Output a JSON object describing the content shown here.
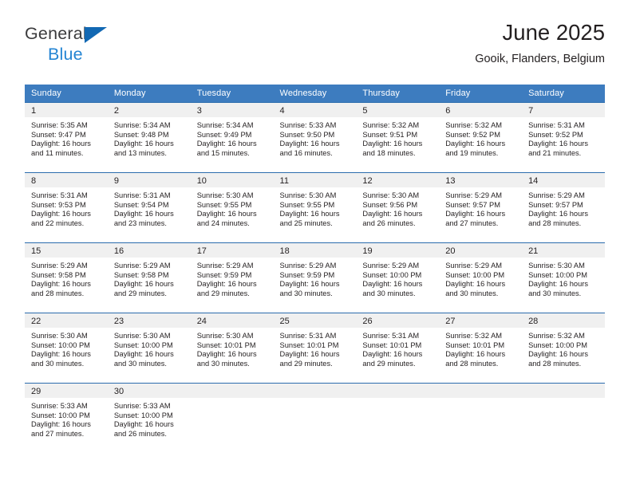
{
  "brand": {
    "name_part1": "General",
    "name_part2": "Blue",
    "triangle_color": "#1268b3",
    "text_color_1": "#3b3b3d",
    "text_color_2": "#2585d3"
  },
  "header": {
    "title": "June 2025",
    "subtitle": "Gooik, Flanders, Belgium"
  },
  "theme": {
    "header_bg": "#3d7cbf",
    "row_divider": "#2b6cad",
    "daynum_bg": "#f0f0f0",
    "text": "#231f20"
  },
  "weekday_headers": [
    "Sunday",
    "Monday",
    "Tuesday",
    "Wednesday",
    "Thursday",
    "Friday",
    "Saturday"
  ],
  "weeks": [
    {
      "days": [
        {
          "num": "1",
          "sunrise": "Sunrise: 5:35 AM",
          "sunset": "Sunset: 9:47 PM",
          "daylight1": "Daylight: 16 hours",
          "daylight2": "and 11 minutes."
        },
        {
          "num": "2",
          "sunrise": "Sunrise: 5:34 AM",
          "sunset": "Sunset: 9:48 PM",
          "daylight1": "Daylight: 16 hours",
          "daylight2": "and 13 minutes."
        },
        {
          "num": "3",
          "sunrise": "Sunrise: 5:34 AM",
          "sunset": "Sunset: 9:49 PM",
          "daylight1": "Daylight: 16 hours",
          "daylight2": "and 15 minutes."
        },
        {
          "num": "4",
          "sunrise": "Sunrise: 5:33 AM",
          "sunset": "Sunset: 9:50 PM",
          "daylight1": "Daylight: 16 hours",
          "daylight2": "and 16 minutes."
        },
        {
          "num": "5",
          "sunrise": "Sunrise: 5:32 AM",
          "sunset": "Sunset: 9:51 PM",
          "daylight1": "Daylight: 16 hours",
          "daylight2": "and 18 minutes."
        },
        {
          "num": "6",
          "sunrise": "Sunrise: 5:32 AM",
          "sunset": "Sunset: 9:52 PM",
          "daylight1": "Daylight: 16 hours",
          "daylight2": "and 19 minutes."
        },
        {
          "num": "7",
          "sunrise": "Sunrise: 5:31 AM",
          "sunset": "Sunset: 9:52 PM",
          "daylight1": "Daylight: 16 hours",
          "daylight2": "and 21 minutes."
        }
      ]
    },
    {
      "days": [
        {
          "num": "8",
          "sunrise": "Sunrise: 5:31 AM",
          "sunset": "Sunset: 9:53 PM",
          "daylight1": "Daylight: 16 hours",
          "daylight2": "and 22 minutes."
        },
        {
          "num": "9",
          "sunrise": "Sunrise: 5:31 AM",
          "sunset": "Sunset: 9:54 PM",
          "daylight1": "Daylight: 16 hours",
          "daylight2": "and 23 minutes."
        },
        {
          "num": "10",
          "sunrise": "Sunrise: 5:30 AM",
          "sunset": "Sunset: 9:55 PM",
          "daylight1": "Daylight: 16 hours",
          "daylight2": "and 24 minutes."
        },
        {
          "num": "11",
          "sunrise": "Sunrise: 5:30 AM",
          "sunset": "Sunset: 9:55 PM",
          "daylight1": "Daylight: 16 hours",
          "daylight2": "and 25 minutes."
        },
        {
          "num": "12",
          "sunrise": "Sunrise: 5:30 AM",
          "sunset": "Sunset: 9:56 PM",
          "daylight1": "Daylight: 16 hours",
          "daylight2": "and 26 minutes."
        },
        {
          "num": "13",
          "sunrise": "Sunrise: 5:29 AM",
          "sunset": "Sunset: 9:57 PM",
          "daylight1": "Daylight: 16 hours",
          "daylight2": "and 27 minutes."
        },
        {
          "num": "14",
          "sunrise": "Sunrise: 5:29 AM",
          "sunset": "Sunset: 9:57 PM",
          "daylight1": "Daylight: 16 hours",
          "daylight2": "and 28 minutes."
        }
      ]
    },
    {
      "days": [
        {
          "num": "15",
          "sunrise": "Sunrise: 5:29 AM",
          "sunset": "Sunset: 9:58 PM",
          "daylight1": "Daylight: 16 hours",
          "daylight2": "and 28 minutes."
        },
        {
          "num": "16",
          "sunrise": "Sunrise: 5:29 AM",
          "sunset": "Sunset: 9:58 PM",
          "daylight1": "Daylight: 16 hours",
          "daylight2": "and 29 minutes."
        },
        {
          "num": "17",
          "sunrise": "Sunrise: 5:29 AM",
          "sunset": "Sunset: 9:59 PM",
          "daylight1": "Daylight: 16 hours",
          "daylight2": "and 29 minutes."
        },
        {
          "num": "18",
          "sunrise": "Sunrise: 5:29 AM",
          "sunset": "Sunset: 9:59 PM",
          "daylight1": "Daylight: 16 hours",
          "daylight2": "and 30 minutes."
        },
        {
          "num": "19",
          "sunrise": "Sunrise: 5:29 AM",
          "sunset": "Sunset: 10:00 PM",
          "daylight1": "Daylight: 16 hours",
          "daylight2": "and 30 minutes."
        },
        {
          "num": "20",
          "sunrise": "Sunrise: 5:29 AM",
          "sunset": "Sunset: 10:00 PM",
          "daylight1": "Daylight: 16 hours",
          "daylight2": "and 30 minutes."
        },
        {
          "num": "21",
          "sunrise": "Sunrise: 5:30 AM",
          "sunset": "Sunset: 10:00 PM",
          "daylight1": "Daylight: 16 hours",
          "daylight2": "and 30 minutes."
        }
      ]
    },
    {
      "days": [
        {
          "num": "22",
          "sunrise": "Sunrise: 5:30 AM",
          "sunset": "Sunset: 10:00 PM",
          "daylight1": "Daylight: 16 hours",
          "daylight2": "and 30 minutes."
        },
        {
          "num": "23",
          "sunrise": "Sunrise: 5:30 AM",
          "sunset": "Sunset: 10:00 PM",
          "daylight1": "Daylight: 16 hours",
          "daylight2": "and 30 minutes."
        },
        {
          "num": "24",
          "sunrise": "Sunrise: 5:30 AM",
          "sunset": "Sunset: 10:01 PM",
          "daylight1": "Daylight: 16 hours",
          "daylight2": "and 30 minutes."
        },
        {
          "num": "25",
          "sunrise": "Sunrise: 5:31 AM",
          "sunset": "Sunset: 10:01 PM",
          "daylight1": "Daylight: 16 hours",
          "daylight2": "and 29 minutes."
        },
        {
          "num": "26",
          "sunrise": "Sunrise: 5:31 AM",
          "sunset": "Sunset: 10:01 PM",
          "daylight1": "Daylight: 16 hours",
          "daylight2": "and 29 minutes."
        },
        {
          "num": "27",
          "sunrise": "Sunrise: 5:32 AM",
          "sunset": "Sunset: 10:01 PM",
          "daylight1": "Daylight: 16 hours",
          "daylight2": "and 28 minutes."
        },
        {
          "num": "28",
          "sunrise": "Sunrise: 5:32 AM",
          "sunset": "Sunset: 10:00 PM",
          "daylight1": "Daylight: 16 hours",
          "daylight2": "and 28 minutes."
        }
      ]
    },
    {
      "days": [
        {
          "num": "29",
          "sunrise": "Sunrise: 5:33 AM",
          "sunset": "Sunset: 10:00 PM",
          "daylight1": "Daylight: 16 hours",
          "daylight2": "and 27 minutes."
        },
        {
          "num": "30",
          "sunrise": "Sunrise: 5:33 AM",
          "sunset": "Sunset: 10:00 PM",
          "daylight1": "Daylight: 16 hours",
          "daylight2": "and 26 minutes."
        },
        {
          "num": "",
          "sunrise": "",
          "sunset": "",
          "daylight1": "",
          "daylight2": ""
        },
        {
          "num": "",
          "sunrise": "",
          "sunset": "",
          "daylight1": "",
          "daylight2": ""
        },
        {
          "num": "",
          "sunrise": "",
          "sunset": "",
          "daylight1": "",
          "daylight2": ""
        },
        {
          "num": "",
          "sunrise": "",
          "sunset": "",
          "daylight1": "",
          "daylight2": ""
        },
        {
          "num": "",
          "sunrise": "",
          "sunset": "",
          "daylight1": "",
          "daylight2": ""
        }
      ]
    }
  ]
}
